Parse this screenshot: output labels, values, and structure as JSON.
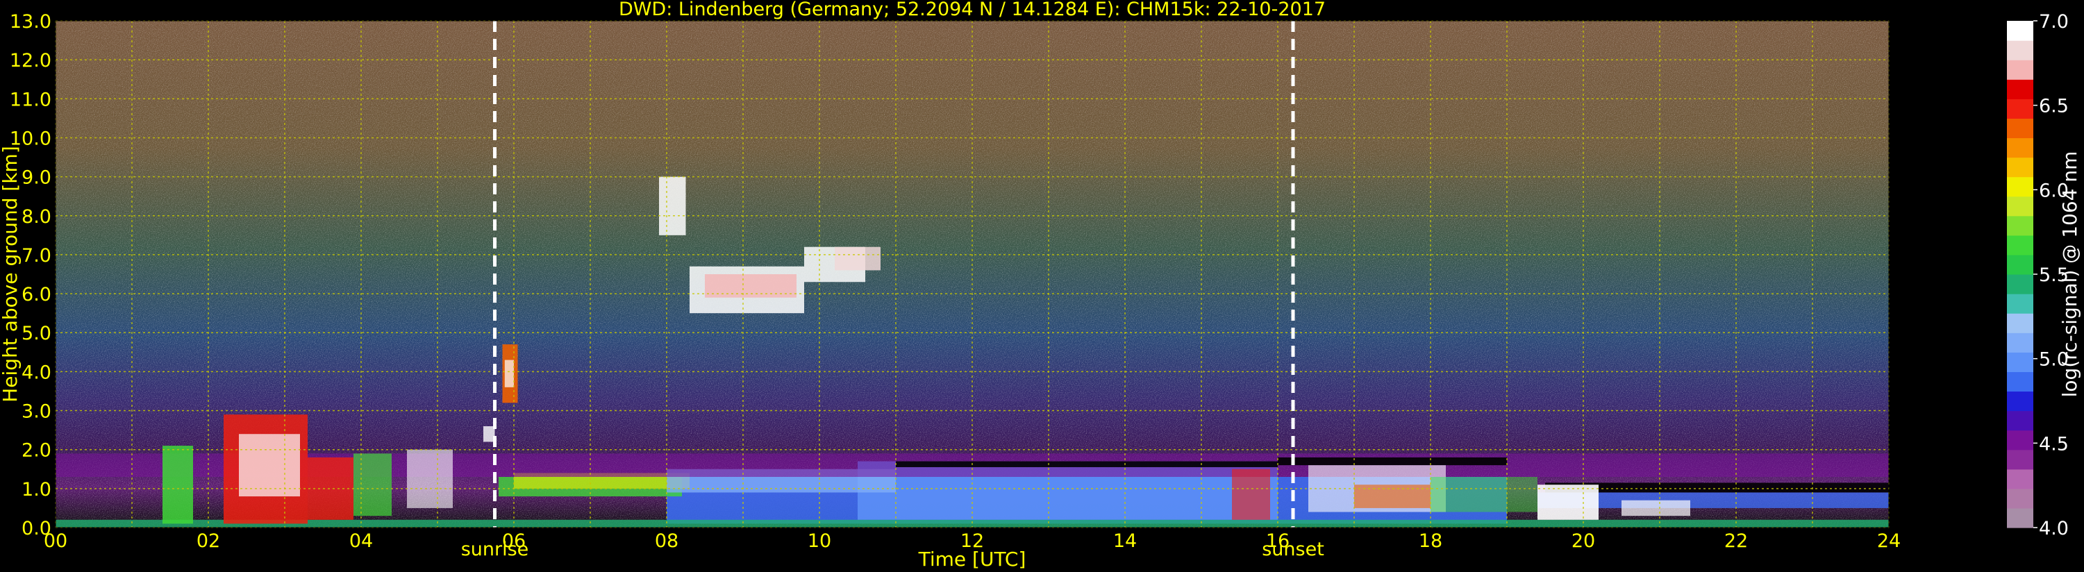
{
  "chart_data": {
    "type": "heatmap",
    "title": "DWD: Lindenberg (Germany; 52.2094 N / 14.1284 E):    CHM15k: 22-10-2017",
    "xlabel": "Time [UTC]",
    "ylabel": "Height above ground [km]",
    "colorbar_label": "log(rc-signal) @ 1064 nm",
    "xlim": [
      0,
      24
    ],
    "ylim": [
      0,
      13
    ],
    "x_ticks": [
      "00",
      "02",
      "04",
      "06",
      "08",
      "10",
      "12",
      "14",
      "16",
      "18",
      "20",
      "22",
      "24"
    ],
    "y_ticks": [
      "0.0",
      "1.0",
      "2.0",
      "3.0",
      "4.0",
      "5.0",
      "6.0",
      "7.0",
      "8.0",
      "9.0",
      "10.0",
      "11.0",
      "12.0",
      "13.0"
    ],
    "colorbar_range": [
      4.0,
      7.0
    ],
    "colorbar_ticks": [
      "4.0",
      "4.5",
      "5.0",
      "5.5",
      "6.0",
      "6.5",
      "7.0"
    ],
    "grid": true,
    "markers": [
      {
        "label": "sunrise",
        "x": 5.75
      },
      {
        "label": "sunset",
        "x": 16.2
      }
    ],
    "colors": {
      "text": "#ffff00",
      "grid": "#c8c800",
      "background": "#000000",
      "colorbar_label": "#ffffff",
      "marker_line": "#ffffff"
    },
    "colormap": [
      "#a88ea8",
      "#b07aa8",
      "#b466b0",
      "#8c2c9c",
      "#7a129a",
      "#4a10b4",
      "#2020d8",
      "#3c6cf0",
      "#5e92f8",
      "#80acf8",
      "#a0c4f4",
      "#40c0b0",
      "#20b070",
      "#28c848",
      "#40d838",
      "#80e030",
      "#c8e828",
      "#f0f000",
      "#f8c000",
      "#f89000",
      "#f06000",
      "#f02010",
      "#e00000",
      "#f4b4b4",
      "#f0d8d8",
      "#ffffff"
    ]
  }
}
